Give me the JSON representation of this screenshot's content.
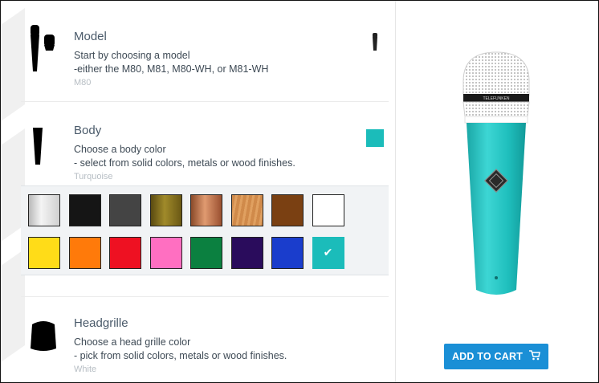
{
  "sections": {
    "model": {
      "title": "Model",
      "line1": "Start by choosing a model",
      "line2": "-either the M80, M81, M80-WH, or M81-WH",
      "value": "M80"
    },
    "body": {
      "title": "Body",
      "line1": "Choose a body color",
      "line2": "- select from solid colors, metals or wood finishes.",
      "value": "Turquoise",
      "selected_color": "#1bbcba"
    },
    "headgrille": {
      "title": "Headgrille",
      "line1": "Choose a head grille color",
      "line2": "- pick from solid colors, metals or wood finishes.",
      "value": "White"
    }
  },
  "swatches": [
    {
      "name": "pearl",
      "color": "#d9d9d9"
    },
    {
      "name": "black",
      "color": "#151515"
    },
    {
      "name": "dark-gray",
      "color": "#444444"
    },
    {
      "name": "olive-gold",
      "color": "#7a6a1d"
    },
    {
      "name": "copper",
      "color": "#b0673f"
    },
    {
      "name": "light-wood",
      "color": "#d1894a"
    },
    {
      "name": "brown",
      "color": "#7a4012"
    },
    {
      "name": "white",
      "color": "#ffffff"
    },
    {
      "name": "yellow",
      "color": "#ffdc18"
    },
    {
      "name": "orange",
      "color": "#ff7a0a"
    },
    {
      "name": "red",
      "color": "#ee1122"
    },
    {
      "name": "pink",
      "color": "#ff6fc1"
    },
    {
      "name": "green",
      "color": "#0b8040"
    },
    {
      "name": "purple",
      "color": "#2a0c5c"
    },
    {
      "name": "blue",
      "color": "#1a3dcc"
    },
    {
      "name": "turquoise",
      "color": "#1bbcba",
      "selected": true
    }
  ],
  "cart": {
    "label": "ADD TO CART",
    "icon": "cart-icon",
    "color": "#1a8fd6"
  },
  "check_glyph": "✔"
}
